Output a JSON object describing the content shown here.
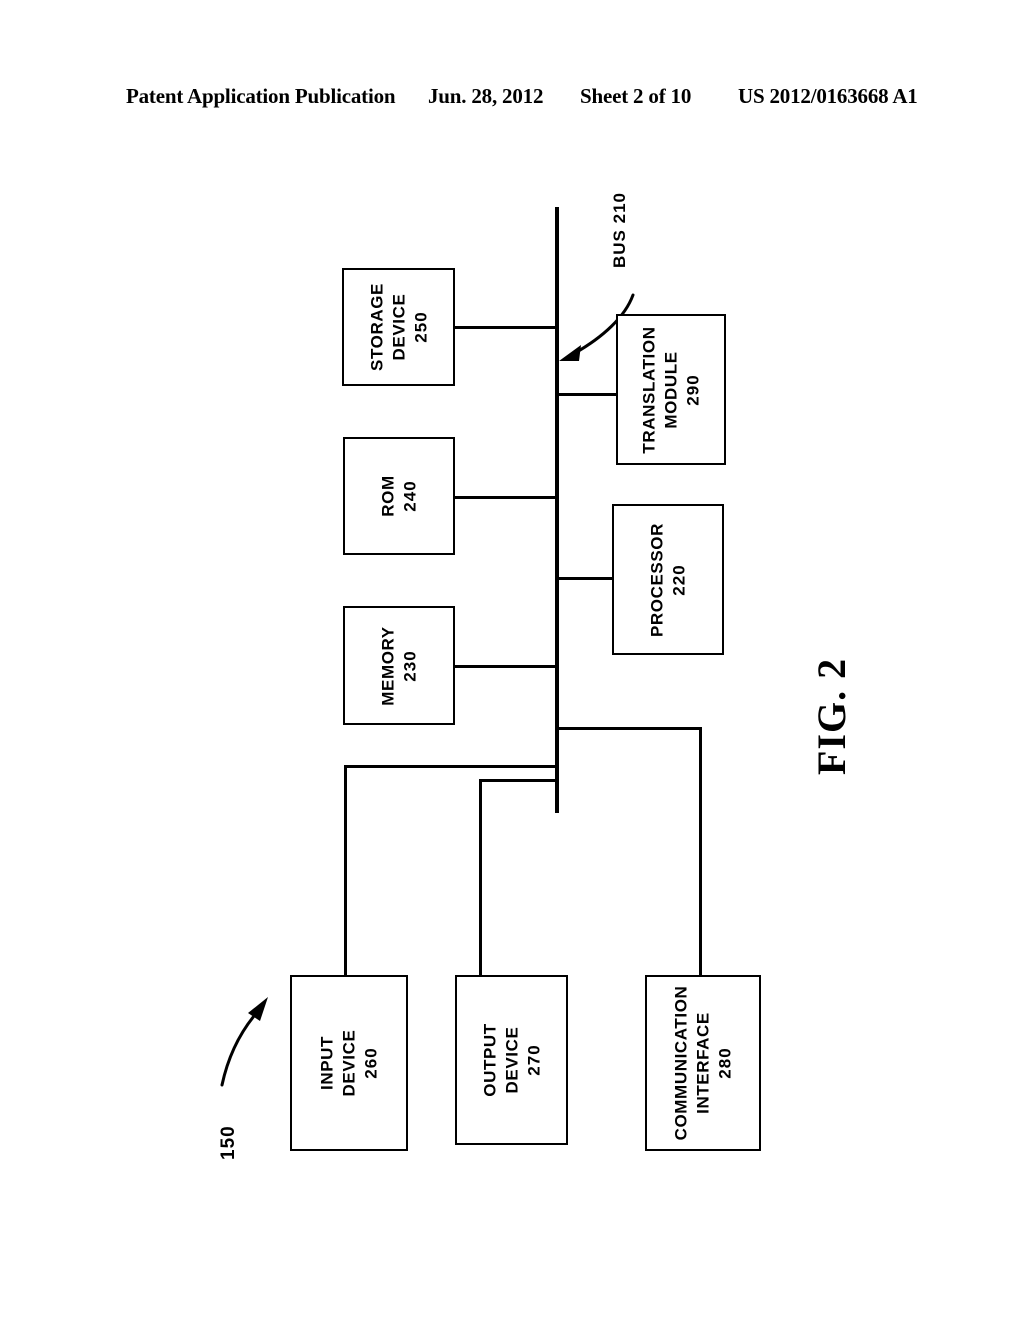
{
  "header": {
    "publication": "Patent Application Publication",
    "date": "Jun. 28, 2012",
    "sheet": "Sheet 2 of 10",
    "patent_number": "US 2012/0163668 A1"
  },
  "figure": {
    "figure_label": "FIG. 2",
    "system_reference": "150",
    "bus_label": "BUS 210",
    "blocks": [
      {
        "name": "storage-device",
        "line1": "STORAGE",
        "line2": "DEVICE",
        "number": "250"
      },
      {
        "name": "rom",
        "line1": "ROM",
        "line2": "",
        "number": "240"
      },
      {
        "name": "memory",
        "line1": "MEMORY",
        "line2": "",
        "number": "230"
      },
      {
        "name": "translation-module",
        "line1": "TRANSLATION",
        "line2": "MODULE",
        "number": "290"
      },
      {
        "name": "processor",
        "line1": "PROCESSOR",
        "line2": "",
        "number": "220"
      },
      {
        "name": "input-device",
        "line1": "INPUT",
        "line2": "DEVICE",
        "number": "260"
      },
      {
        "name": "output-device",
        "line1": "OUTPUT",
        "line2": "DEVICE",
        "number": "270"
      },
      {
        "name": "communication-interface",
        "line1": "COMMUNICATION",
        "line2": "INTERFACE",
        "number": "280"
      }
    ]
  },
  "colors": {
    "ink": "#000000",
    "paper": "#ffffff"
  }
}
